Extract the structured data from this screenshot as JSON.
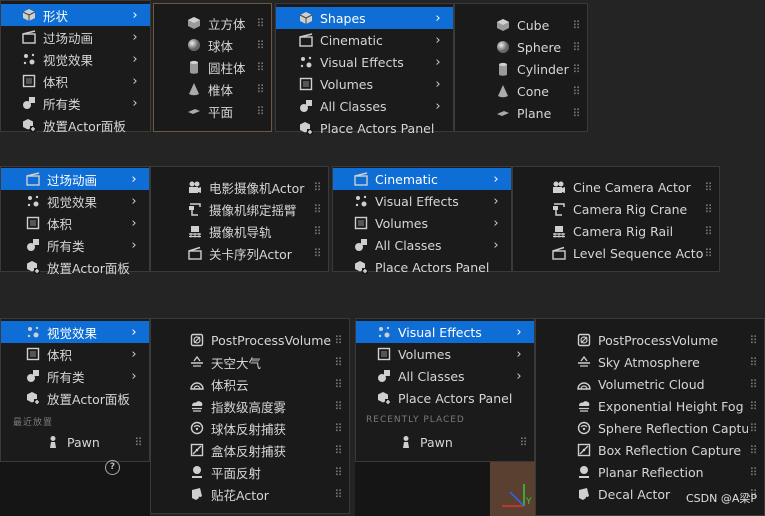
{
  "panel1_cn": {
    "main": [
      {
        "label": "形状",
        "icon": "shape-icon",
        "sub": true
      },
      {
        "label": "过场动画",
        "icon": "cinematic-icon",
        "sub": true
      },
      {
        "label": "视觉效果",
        "icon": "visual-effects-icon",
        "sub": true
      },
      {
        "label": "体积",
        "icon": "volume-icon",
        "sub": true
      },
      {
        "label": "所有类",
        "icon": "all-classes-icon",
        "sub": true
      },
      {
        "label": "放置Actor面板",
        "icon": "place-actors-icon",
        "sub": false
      }
    ],
    "shapes": [
      {
        "label": "立方体",
        "icon": "cube-icon"
      },
      {
        "label": "球体",
        "icon": "sphere-icon"
      },
      {
        "label": "圆柱体",
        "icon": "cylinder-icon"
      },
      {
        "label": "椎体",
        "icon": "cone-icon"
      },
      {
        "label": "平面",
        "icon": "plane-icon"
      }
    ]
  },
  "panel1_en": {
    "main": [
      {
        "label": "Shapes",
        "icon": "shape-icon",
        "sub": true
      },
      {
        "label": "Cinematic",
        "icon": "cinematic-icon",
        "sub": true
      },
      {
        "label": "Visual Effects",
        "icon": "visual-effects-icon",
        "sub": true
      },
      {
        "label": "Volumes",
        "icon": "volume-icon",
        "sub": true
      },
      {
        "label": "All Classes",
        "icon": "all-classes-icon",
        "sub": true
      },
      {
        "label": "Place Actors Panel",
        "icon": "place-actors-icon",
        "sub": false
      }
    ],
    "shapes": [
      {
        "label": "Cube",
        "icon": "cube-icon"
      },
      {
        "label": "Sphere",
        "icon": "sphere-icon"
      },
      {
        "label": "Cylinder",
        "icon": "cylinder-icon"
      },
      {
        "label": "Cone",
        "icon": "cone-icon"
      },
      {
        "label": "Plane",
        "icon": "plane-icon"
      }
    ]
  },
  "panel2_cn": {
    "main": [
      {
        "label": "过场动画",
        "icon": "cinematic-icon",
        "sub": true
      },
      {
        "label": "视觉效果",
        "icon": "visual-effects-icon",
        "sub": true
      },
      {
        "label": "体积",
        "icon": "volume-icon",
        "sub": true
      },
      {
        "label": "所有类",
        "icon": "all-classes-icon",
        "sub": true
      },
      {
        "label": "放置Actor面板",
        "icon": "place-actors-icon",
        "sub": false
      }
    ],
    "cinematic": [
      {
        "label": "电影摄像机Actor",
        "icon": "cine-camera-icon"
      },
      {
        "label": "摄像机绑定摇臂",
        "icon": "camera-crane-icon"
      },
      {
        "label": "摄像机导轨",
        "icon": "camera-rail-icon"
      },
      {
        "label": "关卡序列Actor",
        "icon": "level-sequence-icon"
      }
    ]
  },
  "panel2_en": {
    "main": [
      {
        "label": "Cinematic",
        "icon": "cinematic-icon",
        "sub": true
      },
      {
        "label": "Visual Effects",
        "icon": "visual-effects-icon",
        "sub": true
      },
      {
        "label": "Volumes",
        "icon": "volume-icon",
        "sub": true
      },
      {
        "label": "All Classes",
        "icon": "all-classes-icon",
        "sub": true
      },
      {
        "label": "Place Actors Panel",
        "icon": "place-actors-icon",
        "sub": false
      }
    ],
    "cinematic": [
      {
        "label": "Cine Camera Actor",
        "icon": "cine-camera-icon"
      },
      {
        "label": "Camera Rig Crane",
        "icon": "camera-crane-icon"
      },
      {
        "label": "Camera Rig Rail",
        "icon": "camera-rail-icon"
      },
      {
        "label": "Level Sequence Actor",
        "icon": "level-sequence-icon"
      }
    ]
  },
  "panel3_cn": {
    "main": [
      {
        "label": "视觉效果",
        "icon": "visual-effects-icon",
        "sub": true
      },
      {
        "label": "体积",
        "icon": "volume-icon",
        "sub": true
      },
      {
        "label": "所有类",
        "icon": "all-classes-icon",
        "sub": true
      },
      {
        "label": "放置Actor面板",
        "icon": "place-actors-icon",
        "sub": false
      }
    ],
    "recent_header": "最近放置",
    "recent": [
      {
        "label": "Pawn",
        "icon": "pawn-icon"
      }
    ],
    "help": "?",
    "vfx": [
      {
        "label": "PostProcessVolume",
        "icon": "post-process-icon"
      },
      {
        "label": "天空大气",
        "icon": "sky-atmosphere-icon"
      },
      {
        "label": "体积云",
        "icon": "volumetric-cloud-icon"
      },
      {
        "label": "指数级高度雾",
        "icon": "height-fog-icon"
      },
      {
        "label": "球体反射捕获",
        "icon": "sphere-reflection-icon"
      },
      {
        "label": "盒体反射捕获",
        "icon": "box-reflection-icon"
      },
      {
        "label": "平面反射",
        "icon": "planar-reflection-icon"
      },
      {
        "label": "贴花Actor",
        "icon": "decal-icon"
      }
    ]
  },
  "panel3_en": {
    "main": [
      {
        "label": "Visual Effects",
        "icon": "visual-effects-icon",
        "sub": true
      },
      {
        "label": "Volumes",
        "icon": "volume-icon",
        "sub": true
      },
      {
        "label": "All Classes",
        "icon": "all-classes-icon",
        "sub": true
      },
      {
        "label": "Place Actors Panel",
        "icon": "place-actors-icon",
        "sub": false
      }
    ],
    "recent_header": "RECENTLY PLACED",
    "recent": [
      {
        "label": "Pawn",
        "icon": "pawn-icon"
      }
    ],
    "vfx": [
      {
        "label": "PostProcessVolume",
        "icon": "post-process-icon"
      },
      {
        "label": "Sky Atmosphere",
        "icon": "sky-atmosphere-icon"
      },
      {
        "label": "Volumetric Cloud",
        "icon": "volumetric-cloud-icon"
      },
      {
        "label": "Exponential Height Fog",
        "icon": "height-fog-icon"
      },
      {
        "label": "Sphere Reflection Capture",
        "icon": "sphere-reflection-icon"
      },
      {
        "label": "Box Reflection Capture",
        "icon": "box-reflection-icon"
      },
      {
        "label": "Planar Reflection",
        "icon": "planar-reflection-icon"
      },
      {
        "label": "Decal Actor",
        "icon": "decal-icon"
      }
    ]
  },
  "viewport_axes": {
    "y": "Y"
  },
  "watermark": "CSDN @A梁P",
  "colors": {
    "selected": "#0e6ed6",
    "menu_bg": "#1b1b1b",
    "page_bg": "#242424"
  }
}
